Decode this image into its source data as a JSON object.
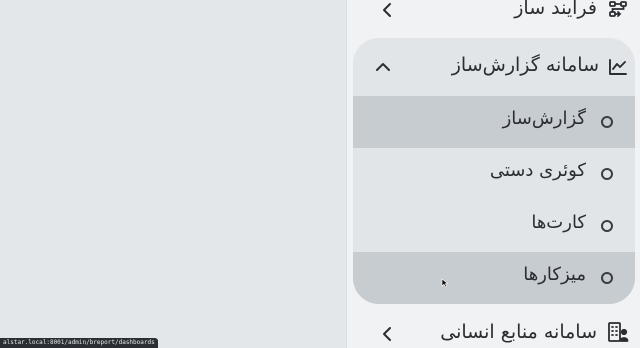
{
  "sidebar": {
    "top_item": {
      "label": "فرایند ساز",
      "icon": "workflow-icon"
    },
    "group": {
      "label": "سامانه گزارش‌ساز",
      "icon": "chart-line-icon",
      "expanded": true,
      "items": [
        {
          "label": "گزارش‌ساز",
          "active": true
        },
        {
          "label": "کوئری دستی",
          "active": false
        },
        {
          "label": "کارت‌ها",
          "active": false
        },
        {
          "label": "میزکارها",
          "active": true
        }
      ]
    },
    "bottom_item": {
      "label": "سامانه منابع انسانی",
      "icon": "building-users-icon"
    }
  },
  "status_bar": {
    "url": "alstar.local:8001/admin/breport/dashboards"
  },
  "colors": {
    "sidebar_bg": "#f1f2f3",
    "group_bg": "#e2e5e8",
    "active_item_bg": "#c7ccd1",
    "text": "#2a2d31"
  }
}
